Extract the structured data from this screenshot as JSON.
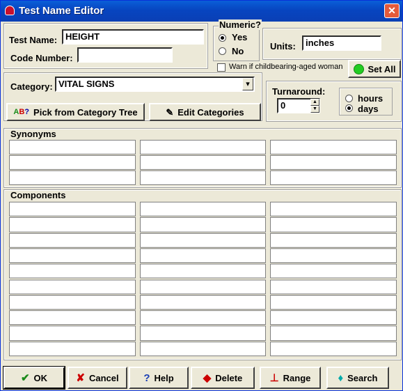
{
  "window": {
    "title": "Test Name Editor",
    "close_glyph": "✕"
  },
  "test_name": {
    "label": "Test Name:",
    "value": "HEIGHT"
  },
  "code_number": {
    "label": "Code Number:",
    "value": ""
  },
  "numeric": {
    "label": "Numeric?",
    "options": [
      "Yes",
      "No"
    ],
    "selected": "Yes"
  },
  "units": {
    "label": "Units:",
    "value": "inches"
  },
  "warn": {
    "label": "Warn if childbearing-aged woman",
    "checked": false
  },
  "set_all": {
    "label": "Set All",
    "indicator_color": "#22cc22"
  },
  "category": {
    "label": "Category:",
    "value": "VITAL SIGNS",
    "dropdown_glyph": "▾"
  },
  "turnaround": {
    "label": "Turnaround:",
    "value": "0",
    "unit_options": [
      "hours",
      "days"
    ],
    "selected": "days",
    "up_glyph": "▲",
    "down_glyph": "▼"
  },
  "buttons": {
    "pick_tree": "Pick from Category Tree",
    "edit_categories": "Edit Categories"
  },
  "synonyms": {
    "label": "Synonyms",
    "rows": 3,
    "cols": 3
  },
  "components": {
    "label": "Components",
    "rows": 10,
    "cols": 3
  },
  "footer": {
    "ok": {
      "label": "OK",
      "glyph": "✔"
    },
    "cancel": {
      "label": "Cancel",
      "glyph": "✘"
    },
    "help": {
      "label": "Help",
      "glyph": "?"
    },
    "delete": {
      "label": "Delete",
      "glyph": "◆"
    },
    "range": {
      "label": "Range",
      "glyph": "⊥"
    },
    "search": {
      "label": "Search",
      "glyph": "♦"
    }
  }
}
